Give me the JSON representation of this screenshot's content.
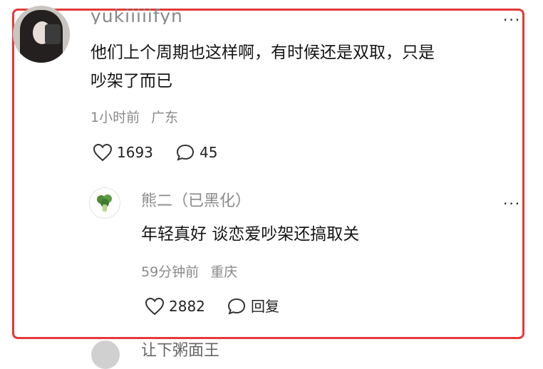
{
  "comment": {
    "username": "yukiiiiifyn",
    "text_line1": "他们上个周期也这样啊，有时候还是双取，只是",
    "text_line2": "吵架了而已",
    "time": "1小时前",
    "location": "广东",
    "likes": "1693",
    "replies": "45"
  },
  "reply": {
    "username": "熊二（已黑化）",
    "text": "年轻真好 谈恋爱吵架还搞取关",
    "time": "59分钟前",
    "location": "重庆",
    "likes": "2882",
    "reply_label": "回复"
  },
  "more_label": "···",
  "next_comment": {
    "username_partial": "让下粥面王"
  },
  "colors": {
    "highlight_border": "#e23a3a",
    "meta_gray": "#8a8a8a"
  },
  "icons": [
    "heart-icon",
    "comment-icon",
    "more-icon",
    "broccoli-avatar-icon"
  ]
}
